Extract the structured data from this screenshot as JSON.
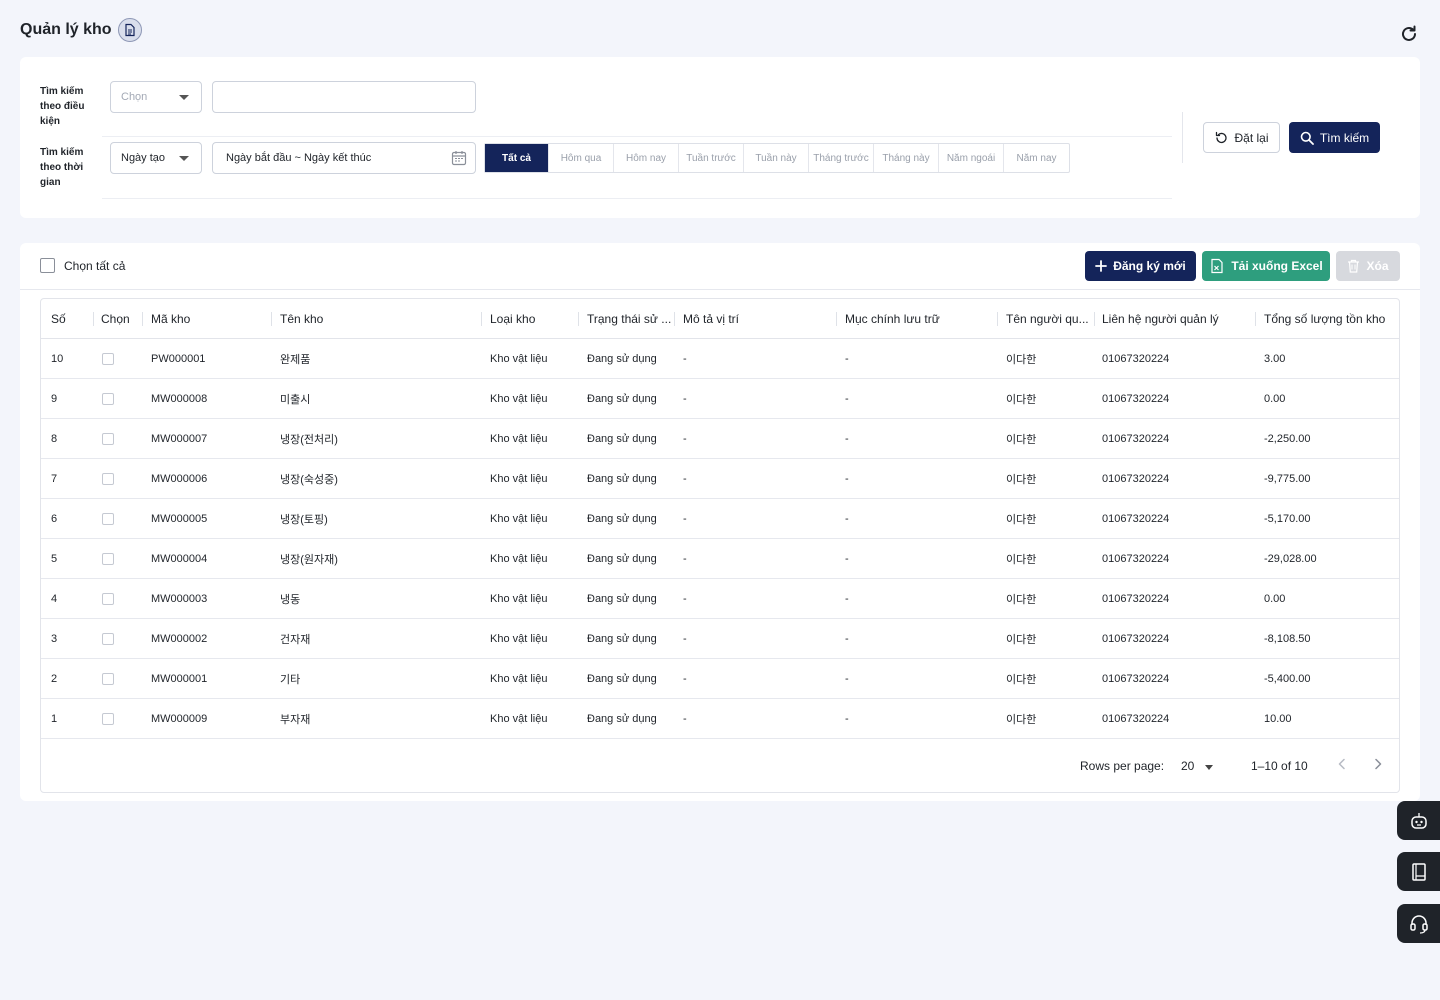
{
  "page": {
    "title": "Quản lý kho"
  },
  "filters": {
    "condition_label": "Tìm kiếm theo điều kiện",
    "condition_select_placeholder": "Chọn",
    "condition_input_value": "",
    "time_label": "Tìm kiếm theo thời gian",
    "time_select_value": "Ngày tạo",
    "date_range_value": "Ngày bắt đầu ~ Ngày kết thúc",
    "quick_ranges": [
      "Tất cả",
      "Hôm qua",
      "Hôm nay",
      "Tuần trước",
      "Tuần này",
      "Tháng trước",
      "Tháng này",
      "Năm ngoái",
      "Năm nay"
    ],
    "active_range": "Tất cả",
    "reset_label": "Đặt lại",
    "search_label": "Tìm kiếm"
  },
  "toolbar": {
    "select_all_label": "Chọn tất cả",
    "new_label": "Đăng ký mới",
    "excel_label": "Tải xuống Excel",
    "delete_label": "Xóa"
  },
  "table": {
    "columns": [
      "Số",
      "Chọn",
      "Mã kho",
      "Tên kho",
      "Loại kho",
      "Trạng thái sử ...",
      "Mô tả vị trí",
      "Mục chính lưu trữ",
      "Tên người qu...",
      "Liên hệ người quản lý",
      "Tổng số lượng tồn kho"
    ],
    "rows": [
      {
        "no": "10",
        "code": "PW000001",
        "name": "완제품",
        "type": "Kho vật liệu",
        "status": "Đang sử dụng",
        "location": "-",
        "main_item": "-",
        "manager": "이다한",
        "contact": "01067320224",
        "total": "3.00"
      },
      {
        "no": "9",
        "code": "MW000008",
        "name": "미출시",
        "type": "Kho vật liệu",
        "status": "Đang sử dụng",
        "location": "-",
        "main_item": "-",
        "manager": "이다한",
        "contact": "01067320224",
        "total": "0.00"
      },
      {
        "no": "8",
        "code": "MW000007",
        "name": "냉장(전처리)",
        "type": "Kho vật liệu",
        "status": "Đang sử dụng",
        "location": "-",
        "main_item": "-",
        "manager": "이다한",
        "contact": "01067320224",
        "total": "-2,250.00"
      },
      {
        "no": "7",
        "code": "MW000006",
        "name": "냉장(숙성중)",
        "type": "Kho vật liệu",
        "status": "Đang sử dụng",
        "location": "-",
        "main_item": "-",
        "manager": "이다한",
        "contact": "01067320224",
        "total": "-9,775.00"
      },
      {
        "no": "6",
        "code": "MW000005",
        "name": "냉장(토핑)",
        "type": "Kho vật liệu",
        "status": "Đang sử dụng",
        "location": "-",
        "main_item": "-",
        "manager": "이다한",
        "contact": "01067320224",
        "total": "-5,170.00"
      },
      {
        "no": "5",
        "code": "MW000004",
        "name": "냉장(원자재)",
        "type": "Kho vật liệu",
        "status": "Đang sử dụng",
        "location": "-",
        "main_item": "-",
        "manager": "이다한",
        "contact": "01067320224",
        "total": "-29,028.00"
      },
      {
        "no": "4",
        "code": "MW000003",
        "name": "냉동",
        "type": "Kho vật liệu",
        "status": "Đang sử dụng",
        "location": "-",
        "main_item": "-",
        "manager": "이다한",
        "contact": "01067320224",
        "total": "0.00"
      },
      {
        "no": "3",
        "code": "MW000002",
        "name": "건자재",
        "type": "Kho vật liệu",
        "status": "Đang sử dụng",
        "location": "-",
        "main_item": "-",
        "manager": "이다한",
        "contact": "01067320224",
        "total": "-8,108.50"
      },
      {
        "no": "2",
        "code": "MW000001",
        "name": "기타",
        "type": "Kho vật liệu",
        "status": "Đang sử dụng",
        "location": "-",
        "main_item": "-",
        "manager": "이다한",
        "contact": "01067320224",
        "total": "-5,400.00"
      },
      {
        "no": "1",
        "code": "MW000009",
        "name": "부자재",
        "type": "Kho vật liệu",
        "status": "Đang sử dụng",
        "location": "-",
        "main_item": "-",
        "manager": "이다한",
        "contact": "01067320224",
        "total": "10.00"
      }
    ]
  },
  "pagination": {
    "rows_per_page_label": "Rows per page:",
    "rows_per_page_value": "20",
    "range_text": "1–10 of 10"
  },
  "floating": {
    "icons": [
      "robot-icon",
      "book-icon",
      "headset-icon"
    ]
  },
  "colors": {
    "primary": "#14245a",
    "excel": "#2e9e7e",
    "disabled": "#d7d9de",
    "background": "#f3f5fb"
  }
}
